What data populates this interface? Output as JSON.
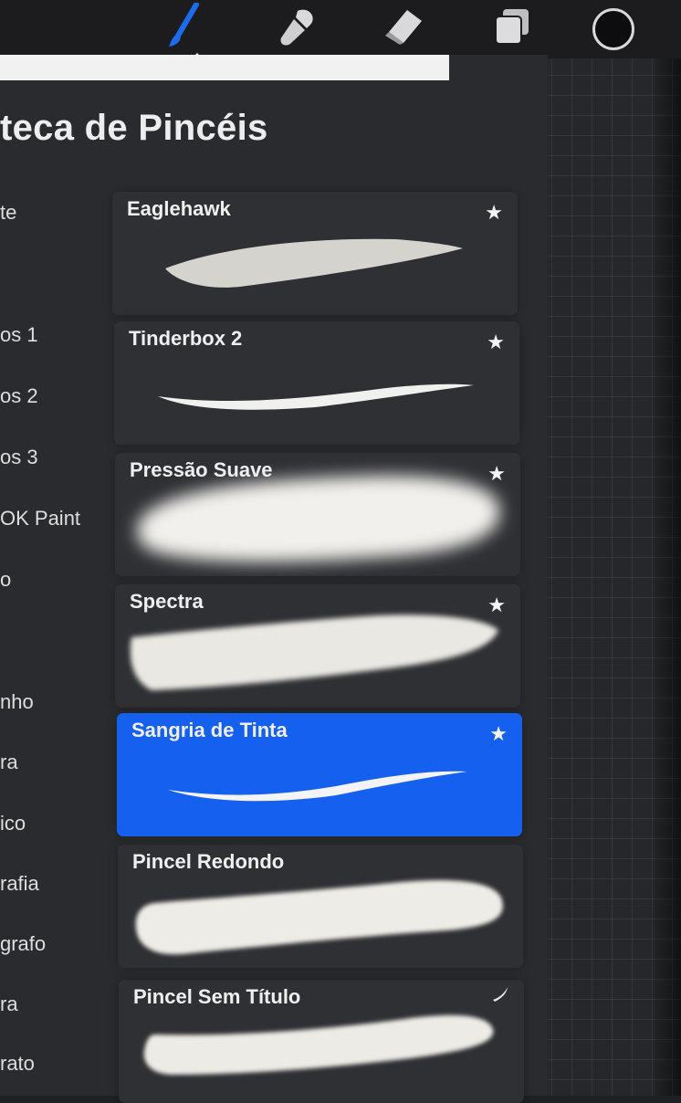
{
  "toolbar": {
    "tools": [
      {
        "icon": "paintbrush-icon",
        "active": true
      },
      {
        "icon": "smudge-icon",
        "active": false
      },
      {
        "icon": "eraser-icon",
        "active": false
      },
      {
        "icon": "layers-icon",
        "active": false
      }
    ],
    "color_swatch": "#0d0d10",
    "accent_color": "#1d6cf0"
  },
  "library": {
    "title": "teca de Pincéis",
    "sets": [
      {
        "label": "te"
      },
      {
        "label": "os 1"
      },
      {
        "label": "os 2"
      },
      {
        "label": "os 3"
      },
      {
        "label": "OK Paint"
      },
      {
        "label": "o"
      },
      {
        "label": "nho"
      },
      {
        "label": "ra"
      },
      {
        "label": "ico"
      },
      {
        "label": "rafia"
      },
      {
        "label": "grafo"
      },
      {
        "label": "ra"
      },
      {
        "label": "rato"
      }
    ]
  },
  "brushes": [
    {
      "name": "Eaglehawk",
      "starred": true,
      "selected": false
    },
    {
      "name": "Tinderbox 2",
      "starred": true,
      "selected": false
    },
    {
      "name": "Pressão Suave",
      "starred": true,
      "selected": false
    },
    {
      "name": "Spectra",
      "starred": true,
      "selected": false
    },
    {
      "name": "Sangria de Tinta",
      "starred": true,
      "selected": true
    },
    {
      "name": "Pincel Redondo",
      "starred": false,
      "selected": false
    },
    {
      "name": "Pincel Sem Título",
      "starred": false,
      "selected": false
    }
  ],
  "icons": {
    "star": "★"
  }
}
